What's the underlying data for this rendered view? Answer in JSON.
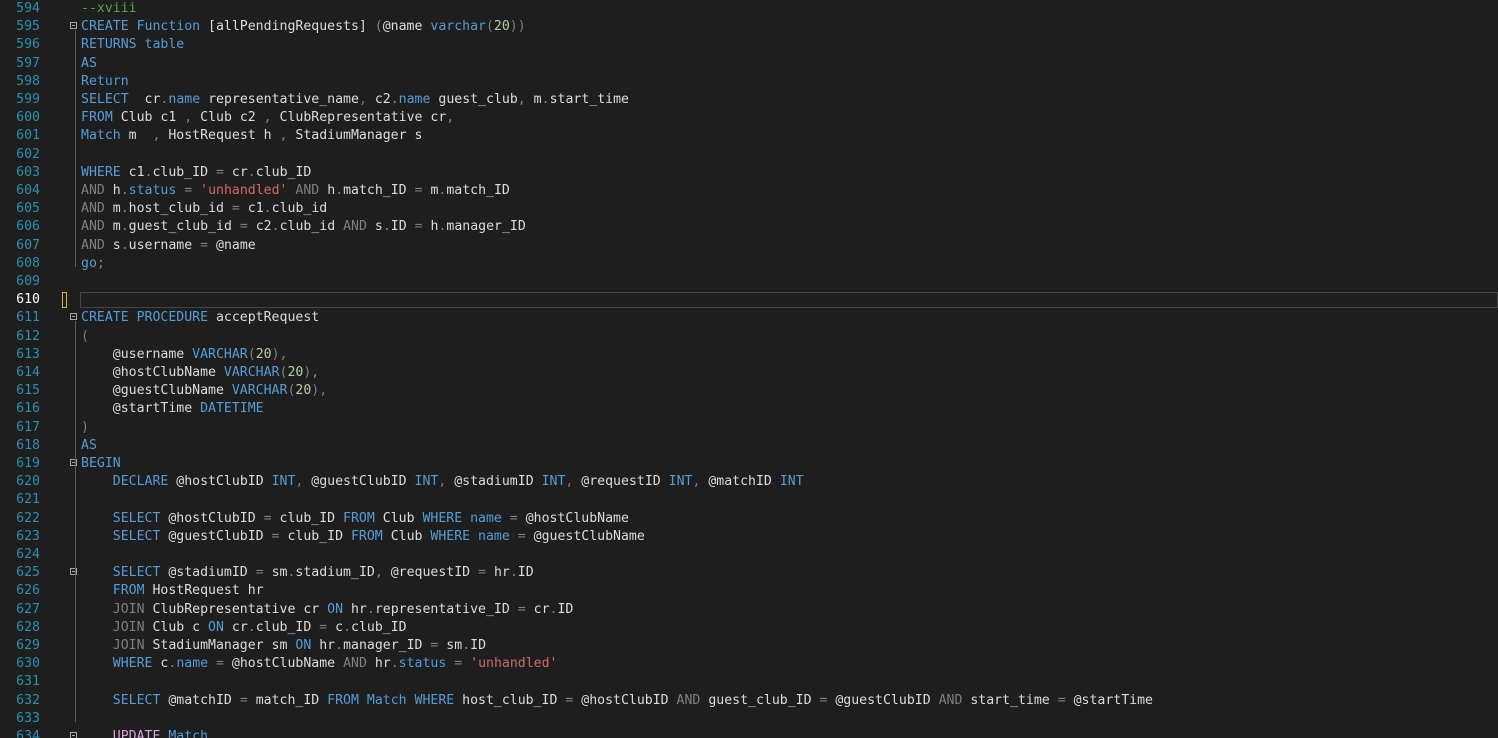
{
  "editor": {
    "colors": {
      "background": "#1e1e1e",
      "line_number": "#2b91af",
      "keyword": "#569cd6",
      "operator": "#808080",
      "identifier": "#dcdcdc",
      "string": "#d16969",
      "comment": "#57a64a",
      "number": "#b5cea8"
    },
    "current_line": 610,
    "lines": [
      {
        "n": "594",
        "t": [
          [
            "c",
            "--xviii"
          ]
        ]
      },
      {
        "n": "595",
        "fold": true,
        "t": [
          [
            "k",
            "CREATE "
          ],
          [
            "k",
            "Function "
          ],
          [
            "i",
            "[allPendingRequests] "
          ],
          [
            "g",
            "("
          ],
          [
            "i",
            "@name "
          ],
          [
            "k",
            "varchar"
          ],
          [
            "g",
            "("
          ],
          [
            "n",
            "20"
          ],
          [
            "g",
            "))"
          ]
        ]
      },
      {
        "n": "596",
        "t": [
          [
            "k",
            "RETURNS "
          ],
          [
            "k",
            "table"
          ]
        ]
      },
      {
        "n": "597",
        "t": [
          [
            "k",
            "AS"
          ]
        ]
      },
      {
        "n": "598",
        "t": [
          [
            "k",
            "Return"
          ]
        ]
      },
      {
        "n": "599",
        "t": [
          [
            "k",
            "SELECT  "
          ],
          [
            "i",
            "cr"
          ],
          [
            "g",
            "."
          ],
          [
            "k",
            "name "
          ],
          [
            "i",
            "representative_name"
          ],
          [
            "g",
            ", "
          ],
          [
            "i",
            "c2"
          ],
          [
            "g",
            "."
          ],
          [
            "k",
            "name "
          ],
          [
            "i",
            "guest_club"
          ],
          [
            "g",
            ", "
          ],
          [
            "i",
            "m"
          ],
          [
            "g",
            "."
          ],
          [
            "i",
            "start_time"
          ]
        ]
      },
      {
        "n": "600",
        "t": [
          [
            "k",
            "FROM "
          ],
          [
            "i",
            "Club c1 "
          ],
          [
            "g",
            ", "
          ],
          [
            "i",
            "Club c2 "
          ],
          [
            "g",
            ", "
          ],
          [
            "i",
            "ClubRepresentative cr"
          ],
          [
            "g",
            ","
          ]
        ]
      },
      {
        "n": "601",
        "t": [
          [
            "k",
            "Match "
          ],
          [
            "i",
            "m  "
          ],
          [
            "g",
            ", "
          ],
          [
            "i",
            "HostRequest h "
          ],
          [
            "g",
            ", "
          ],
          [
            "i",
            "StadiumManager s"
          ]
        ]
      },
      {
        "n": "602",
        "t": []
      },
      {
        "n": "603",
        "t": [
          [
            "k",
            "WHERE "
          ],
          [
            "i",
            "c1"
          ],
          [
            "g",
            "."
          ],
          [
            "i",
            "club_ID "
          ],
          [
            "g",
            "= "
          ],
          [
            "i",
            "cr"
          ],
          [
            "g",
            "."
          ],
          [
            "i",
            "club_ID"
          ]
        ]
      },
      {
        "n": "604",
        "t": [
          [
            "g",
            "AND "
          ],
          [
            "i",
            "h"
          ],
          [
            "g",
            "."
          ],
          [
            "k",
            "status "
          ],
          [
            "g",
            "= "
          ],
          [
            "s",
            "'unhandled' "
          ],
          [
            "g",
            "AND "
          ],
          [
            "i",
            "h"
          ],
          [
            "g",
            "."
          ],
          [
            "i",
            "match_ID "
          ],
          [
            "g",
            "= "
          ],
          [
            "i",
            "m"
          ],
          [
            "g",
            "."
          ],
          [
            "i",
            "match_ID"
          ]
        ]
      },
      {
        "n": "605",
        "t": [
          [
            "g",
            "AND "
          ],
          [
            "i",
            "m"
          ],
          [
            "g",
            "."
          ],
          [
            "i",
            "host_club_id "
          ],
          [
            "g",
            "= "
          ],
          [
            "i",
            "c1"
          ],
          [
            "g",
            "."
          ],
          [
            "i",
            "club_id"
          ]
        ]
      },
      {
        "n": "606",
        "t": [
          [
            "g",
            "AND "
          ],
          [
            "i",
            "m"
          ],
          [
            "g",
            "."
          ],
          [
            "i",
            "guest_club_id "
          ],
          [
            "g",
            "= "
          ],
          [
            "i",
            "c2"
          ],
          [
            "g",
            "."
          ],
          [
            "i",
            "club_id "
          ],
          [
            "g",
            "AND "
          ],
          [
            "i",
            "s"
          ],
          [
            "g",
            "."
          ],
          [
            "i",
            "ID "
          ],
          [
            "g",
            "= "
          ],
          [
            "i",
            "h"
          ],
          [
            "g",
            "."
          ],
          [
            "i",
            "manager_ID"
          ]
        ]
      },
      {
        "n": "607",
        "t": [
          [
            "g",
            "AND "
          ],
          [
            "i",
            "s"
          ],
          [
            "g",
            "."
          ],
          [
            "i",
            "username "
          ],
          [
            "g",
            "= "
          ],
          [
            "i",
            "@name"
          ]
        ]
      },
      {
        "n": "608",
        "t": [
          [
            "k",
            "go"
          ],
          [
            "g",
            ";"
          ]
        ]
      },
      {
        "n": "609",
        "t": []
      },
      {
        "n": "610",
        "active": true,
        "t": []
      },
      {
        "n": "611",
        "fold": true,
        "t": [
          [
            "k",
            "CREATE "
          ],
          [
            "k",
            "PROCEDURE "
          ],
          [
            "i",
            "acceptRequest"
          ]
        ]
      },
      {
        "n": "612",
        "t": [
          [
            "g",
            "("
          ]
        ]
      },
      {
        "n": "613",
        "t": [
          [
            "i",
            "    @username "
          ],
          [
            "k",
            "VARCHAR"
          ],
          [
            "g",
            "("
          ],
          [
            "n",
            "20"
          ],
          [
            "g",
            "),"
          ]
        ]
      },
      {
        "n": "614",
        "t": [
          [
            "i",
            "    @hostClubName "
          ],
          [
            "k",
            "VARCHAR"
          ],
          [
            "g",
            "("
          ],
          [
            "n",
            "20"
          ],
          [
            "g",
            "),"
          ]
        ]
      },
      {
        "n": "615",
        "t": [
          [
            "i",
            "    @guestClubName "
          ],
          [
            "k",
            "VARCHAR"
          ],
          [
            "g",
            "("
          ],
          [
            "n",
            "20"
          ],
          [
            "g",
            "),"
          ]
        ]
      },
      {
        "n": "616",
        "t": [
          [
            "i",
            "    @startTime "
          ],
          [
            "k",
            "DATETIME"
          ]
        ]
      },
      {
        "n": "617",
        "t": [
          [
            "g",
            ")"
          ]
        ]
      },
      {
        "n": "618",
        "t": [
          [
            "k",
            "AS"
          ]
        ]
      },
      {
        "n": "619",
        "fold": true,
        "t": [
          [
            "k",
            "BEGIN"
          ]
        ]
      },
      {
        "n": "620",
        "t": [
          [
            "i",
            "    "
          ],
          [
            "k",
            "DECLARE "
          ],
          [
            "i",
            "@hostClubID "
          ],
          [
            "k",
            "INT"
          ],
          [
            "g",
            ", "
          ],
          [
            "i",
            "@guestClubID "
          ],
          [
            "k",
            "INT"
          ],
          [
            "g",
            ", "
          ],
          [
            "i",
            "@stadiumID "
          ],
          [
            "k",
            "INT"
          ],
          [
            "g",
            ", "
          ],
          [
            "i",
            "@requestID "
          ],
          [
            "k",
            "INT"
          ],
          [
            "g",
            ", "
          ],
          [
            "i",
            "@matchID "
          ],
          [
            "k",
            "INT"
          ]
        ]
      },
      {
        "n": "621",
        "t": []
      },
      {
        "n": "622",
        "t": [
          [
            "i",
            "    "
          ],
          [
            "k",
            "SELECT "
          ],
          [
            "i",
            "@hostClubID "
          ],
          [
            "g",
            "= "
          ],
          [
            "i",
            "club_ID "
          ],
          [
            "k",
            "FROM "
          ],
          [
            "i",
            "Club "
          ],
          [
            "k",
            "WHERE "
          ],
          [
            "k",
            "name "
          ],
          [
            "g",
            "= "
          ],
          [
            "i",
            "@hostClubName"
          ]
        ]
      },
      {
        "n": "623",
        "t": [
          [
            "i",
            "    "
          ],
          [
            "k",
            "SELECT "
          ],
          [
            "i",
            "@guestClubID "
          ],
          [
            "g",
            "= "
          ],
          [
            "i",
            "club_ID "
          ],
          [
            "k",
            "FROM "
          ],
          [
            "i",
            "Club "
          ],
          [
            "k",
            "WHERE "
          ],
          [
            "k",
            "name "
          ],
          [
            "g",
            "= "
          ],
          [
            "i",
            "@guestClubName"
          ]
        ]
      },
      {
        "n": "624",
        "t": []
      },
      {
        "n": "625",
        "fold": true,
        "t": [
          [
            "i",
            "    "
          ],
          [
            "k",
            "SELECT "
          ],
          [
            "i",
            "@stadiumID "
          ],
          [
            "g",
            "= "
          ],
          [
            "i",
            "sm"
          ],
          [
            "g",
            "."
          ],
          [
            "i",
            "stadium_ID"
          ],
          [
            "g",
            ", "
          ],
          [
            "i",
            "@requestID "
          ],
          [
            "g",
            "= "
          ],
          [
            "i",
            "hr"
          ],
          [
            "g",
            "."
          ],
          [
            "i",
            "ID"
          ]
        ]
      },
      {
        "n": "626",
        "t": [
          [
            "i",
            "    "
          ],
          [
            "k",
            "FROM "
          ],
          [
            "i",
            "HostRequest hr"
          ]
        ]
      },
      {
        "n": "627",
        "t": [
          [
            "i",
            "    "
          ],
          [
            "g",
            "JOIN "
          ],
          [
            "i",
            "ClubRepresentative cr "
          ],
          [
            "k",
            "ON "
          ],
          [
            "i",
            "hr"
          ],
          [
            "g",
            "."
          ],
          [
            "i",
            "representative_ID "
          ],
          [
            "g",
            "= "
          ],
          [
            "i",
            "cr"
          ],
          [
            "g",
            "."
          ],
          [
            "i",
            "ID"
          ]
        ]
      },
      {
        "n": "628",
        "t": [
          [
            "i",
            "    "
          ],
          [
            "g",
            "JOIN "
          ],
          [
            "i",
            "Club c "
          ],
          [
            "k",
            "ON "
          ],
          [
            "i",
            "cr"
          ],
          [
            "g",
            "."
          ],
          [
            "i",
            "club_ID "
          ],
          [
            "g",
            "= "
          ],
          [
            "i",
            "c"
          ],
          [
            "g",
            "."
          ],
          [
            "i",
            "club_ID"
          ]
        ]
      },
      {
        "n": "629",
        "t": [
          [
            "i",
            "    "
          ],
          [
            "g",
            "JOIN "
          ],
          [
            "i",
            "StadiumManager sm "
          ],
          [
            "k",
            "ON "
          ],
          [
            "i",
            "hr"
          ],
          [
            "g",
            "."
          ],
          [
            "i",
            "manager_ID "
          ],
          [
            "g",
            "= "
          ],
          [
            "i",
            "sm"
          ],
          [
            "g",
            "."
          ],
          [
            "i",
            "ID"
          ]
        ]
      },
      {
        "n": "630",
        "t": [
          [
            "i",
            "    "
          ],
          [
            "k",
            "WHERE "
          ],
          [
            "i",
            "c"
          ],
          [
            "g",
            "."
          ],
          [
            "k",
            "name "
          ],
          [
            "g",
            "= "
          ],
          [
            "i",
            "@hostClubName "
          ],
          [
            "g",
            "AND "
          ],
          [
            "i",
            "hr"
          ],
          [
            "g",
            "."
          ],
          [
            "k",
            "status "
          ],
          [
            "g",
            "= "
          ],
          [
            "s",
            "'unhandled'"
          ]
        ]
      },
      {
        "n": "631",
        "t": []
      },
      {
        "n": "632",
        "t": [
          [
            "i",
            "    "
          ],
          [
            "k",
            "SELECT "
          ],
          [
            "i",
            "@matchID "
          ],
          [
            "g",
            "= "
          ],
          [
            "i",
            "match_ID "
          ],
          [
            "k",
            "FROM "
          ],
          [
            "k",
            "Match "
          ],
          [
            "k",
            "WHERE "
          ],
          [
            "i",
            "host_club_ID "
          ],
          [
            "g",
            "= "
          ],
          [
            "i",
            "@hostClubID "
          ],
          [
            "g",
            "AND "
          ],
          [
            "i",
            "guest_club_ID "
          ],
          [
            "g",
            "= "
          ],
          [
            "i",
            "@guestClubID "
          ],
          [
            "g",
            "AND "
          ],
          [
            "i",
            "start_time "
          ],
          [
            "g",
            "= "
          ],
          [
            "i",
            "@startTime"
          ]
        ]
      },
      {
        "n": "633",
        "t": []
      },
      {
        "n": "634",
        "fold": true,
        "t": [
          [
            "i",
            "    "
          ],
          [
            "tk",
            "UPDATE "
          ],
          [
            "k",
            "Match"
          ]
        ]
      }
    ]
  }
}
